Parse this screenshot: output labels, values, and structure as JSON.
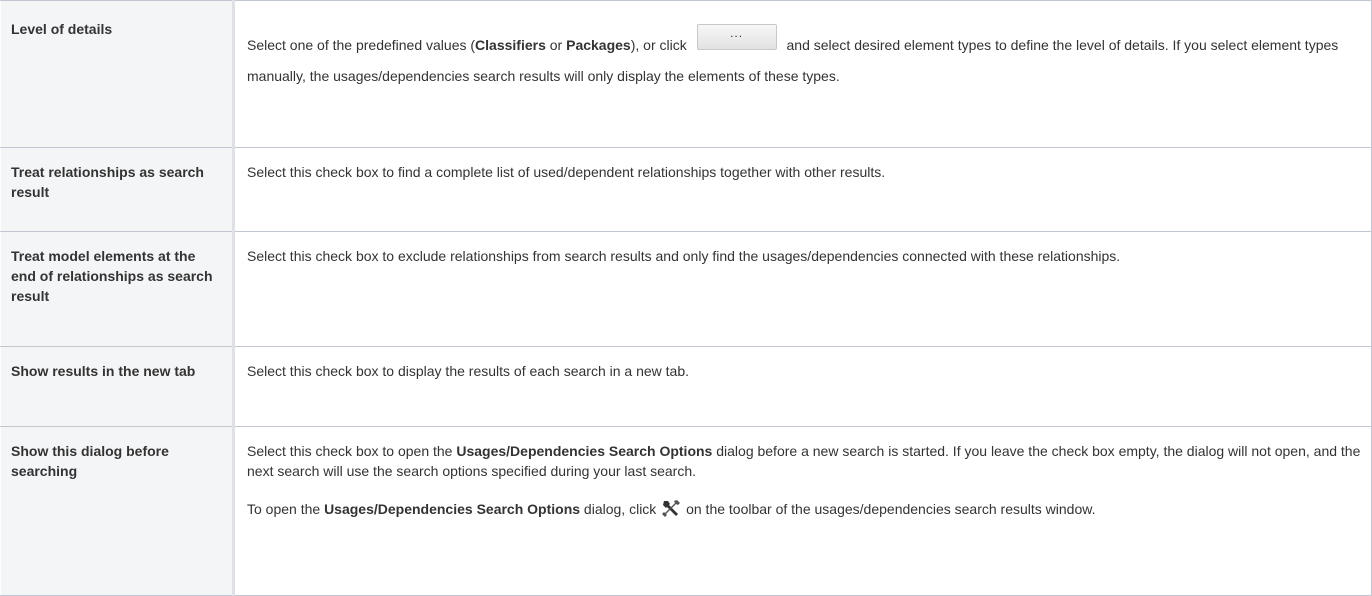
{
  "rows": [
    {
      "label": "Level of details",
      "text_before": "Select one of the predefined values (",
      "bold_1": "Classifiers",
      "text_mid": " or ",
      "bold_2": "Packages",
      "text_after_bold": "), or click ",
      "button_label": "...",
      "text_end": " and select desired element types to define the level of details. If you select element types manually, the usages/dependencies search results will only display the elements of these types."
    },
    {
      "label": "Treat relationships as search result",
      "text": "Select this check box to find a complete list of used/dependent relationships together with other results."
    },
    {
      "label": "Treat model elements at the end of relationships as search result",
      "text": "Select this check box to exclude relationships from search results and only find the usages/dependencies connected with these relationships."
    },
    {
      "label": "Show results in the new tab",
      "text": "Select this check box to display the results of each search in a new tab."
    },
    {
      "label": "Show this dialog before searching",
      "p1_before": "Select this check box to open the ",
      "p1_bold": "Usages/Dependencies Search Options",
      "p1_after": " dialog before a new search is started. If you leave the check box empty, the dialog will not open, and the next search will use the search options specified during your last search.",
      "p2_before": "To open the ",
      "p2_bold": "Usages/Dependencies Search Options",
      "p2_mid": " dialog, click ",
      "p2_after": " on the toolbar of the usages/dependencies search results window.",
      "icon": "tools-icon"
    }
  ]
}
